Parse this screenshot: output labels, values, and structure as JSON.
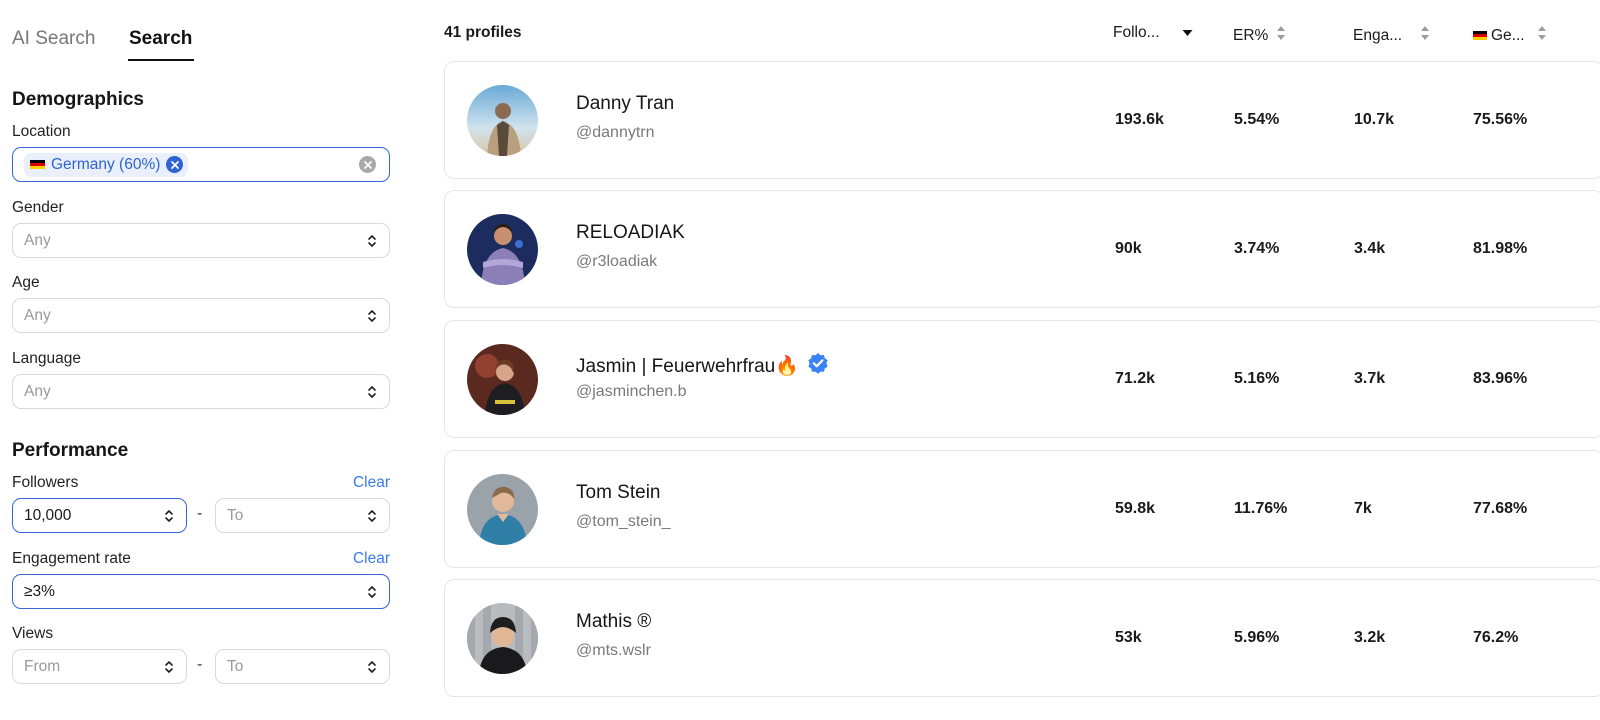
{
  "sidebar": {
    "tabs": [
      {
        "label": "AI Search",
        "active": false
      },
      {
        "label": "Search",
        "active": true
      }
    ],
    "demographics": {
      "title": "Demographics",
      "location": {
        "label": "Location",
        "chip": "Germany (60%)"
      },
      "gender": {
        "label": "Gender",
        "placeholder": "Any"
      },
      "age": {
        "label": "Age",
        "placeholder": "Any"
      },
      "language": {
        "label": "Language",
        "placeholder": "Any"
      }
    },
    "performance": {
      "title": "Performance",
      "followers": {
        "label": "Followers",
        "clear": "Clear",
        "from_value": "10,000",
        "to_placeholder": "To"
      },
      "engagement": {
        "label": "Engagement rate",
        "clear": "Clear",
        "value": "≥3%"
      },
      "views": {
        "label": "Views",
        "from_placeholder": "From",
        "to_placeholder": "To"
      }
    }
  },
  "results": {
    "count": "41 profiles",
    "columns": [
      {
        "label": "Follo...",
        "sort": "desc"
      },
      {
        "label": "ER%",
        "sort": "none"
      },
      {
        "label": "Enga...",
        "sort": "none"
      },
      {
        "label": "Ge...",
        "sort": "none",
        "flag": "germany"
      }
    ],
    "profiles": [
      {
        "name": "Danny Tran",
        "handle": "@dannytrn",
        "followers": "193.6k",
        "er": "5.54%",
        "engagement": "10.7k",
        "germany": "75.56%",
        "verified": false
      },
      {
        "name": "RELOADIAK",
        "handle": "@r3loadiak",
        "followers": "90k",
        "er": "3.74%",
        "engagement": "3.4k",
        "germany": "81.98%",
        "verified": false
      },
      {
        "name": "Jasmin | Feuerwehrfrau🔥",
        "handle": "@jasminchen.b",
        "followers": "71.2k",
        "er": "5.16%",
        "engagement": "3.7k",
        "germany": "83.96%",
        "verified": true
      },
      {
        "name": "Tom Stein",
        "handle": "@tom_stein_",
        "followers": "59.8k",
        "er": "11.76%",
        "engagement": "7k",
        "germany": "77.68%",
        "verified": false
      },
      {
        "name": "Mathis ®",
        "handle": "@mts.wslr",
        "followers": "53k",
        "er": "5.96%",
        "engagement": "3.2k",
        "germany": "76.2%",
        "verified": false
      }
    ]
  },
  "colors": {
    "accent": "#3567d6",
    "link": "#3a7be8",
    "chip_bg": "#e9f0fb",
    "verified": "#3b82f6"
  }
}
